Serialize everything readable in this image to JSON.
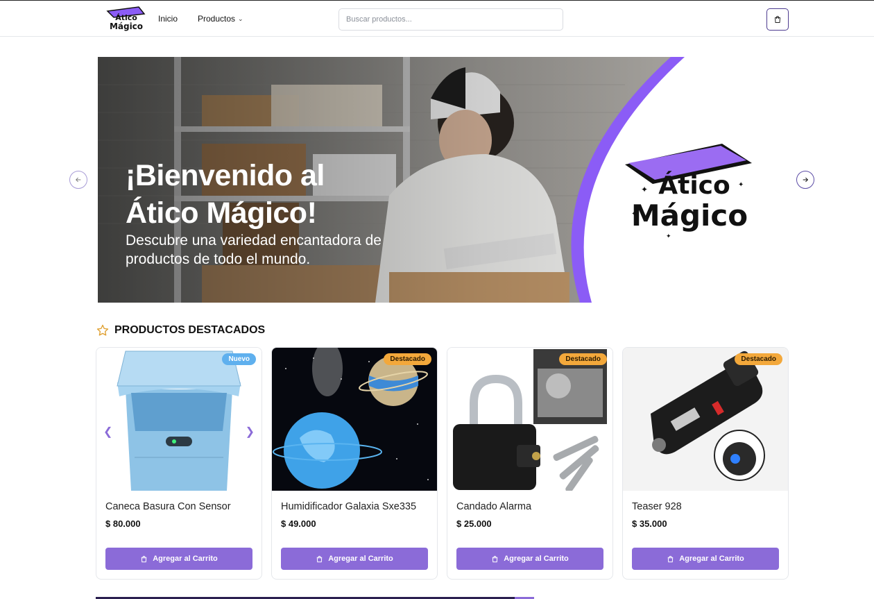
{
  "header": {
    "logo_text": [
      "Ático",
      "Mágico"
    ],
    "nav": [
      {
        "label": "Inicio"
      },
      {
        "label": "Productos"
      }
    ],
    "search": {
      "placeholder": "Buscar productos...",
      "value": ""
    },
    "cart_icon": "shopping-bag-icon"
  },
  "hero": {
    "title": "¡Bienvenido al\nÁtico Mágico!",
    "subtitle": "Descubre una variedad encantadora de productos de todo el mundo.",
    "logo_text": [
      "Ático",
      "Mágico"
    ],
    "accent_color": "#8b5cf6"
  },
  "featured": {
    "title": "PRODUCTOS DESTACADOS",
    "icon": "star-icon",
    "products": [
      {
        "name": "Caneca Basura Con Sensor",
        "price": "$ 80.000",
        "badge": "Nuevo",
        "button": "Agregar al Carrito"
      },
      {
        "name": "Humidificador Galaxia Sxe335",
        "price": "$ 49.000",
        "badge": "Destacado",
        "button": "Agregar al Carrito"
      },
      {
        "name": "Candado Alarma",
        "price": "$ 25.000",
        "badge": "Destacado",
        "button": "Agregar al Carrito"
      },
      {
        "name": "Teaser 928",
        "price": "$ 35.000",
        "badge": "Destacado",
        "button": "Agregar al Carrito"
      }
    ]
  },
  "colors": {
    "primary": "#8b6bd8",
    "badge_new": "#5fb0ee",
    "badge_featured": "#f3a83b"
  }
}
